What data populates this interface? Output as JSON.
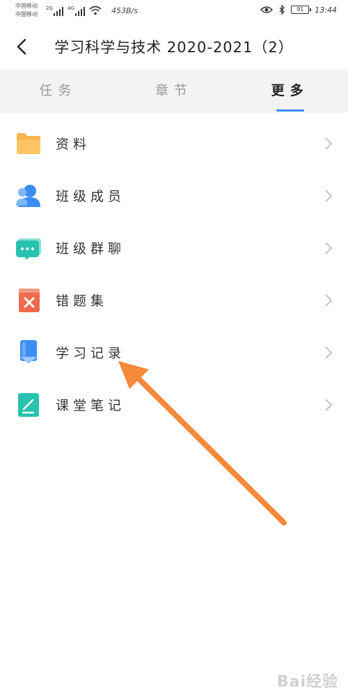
{
  "status_bar": {
    "carrier_1": "中国移动",
    "carrier_2": "中国移动",
    "sig_1": "2G",
    "sig_2": "4G",
    "speed": "453B/s",
    "battery": "91",
    "time": "13:44"
  },
  "header": {
    "title": "学习科学与技术 2020-2021（2）"
  },
  "tabs": [
    {
      "label": "任务",
      "active": false
    },
    {
      "label": "章节",
      "active": false
    },
    {
      "label": "更多",
      "active": true
    }
  ],
  "list": [
    {
      "label": "资料",
      "icon": "folder-icon",
      "color": "#f8b44a"
    },
    {
      "label": "班级成员",
      "icon": "member-icon",
      "color": "#3a8ef6"
    },
    {
      "label": "班级群聊",
      "icon": "chat-icon",
      "color": "#27c2b0"
    },
    {
      "label": "错题集",
      "icon": "wrong-book-icon",
      "color": "#f06b4c"
    },
    {
      "label": "学习记录",
      "icon": "record-icon",
      "color": "#3a8ef6"
    },
    {
      "label": "课堂笔记",
      "icon": "note-icon",
      "color": "#27c2b0"
    }
  ],
  "colors": {
    "accent": "#3a8ef6",
    "arrow": "#f5893a",
    "tab_bg": "#f2f3f5"
  },
  "watermark": "Bai经验"
}
